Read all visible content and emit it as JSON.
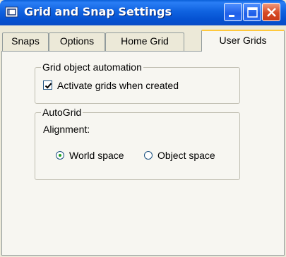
{
  "window": {
    "title": "Grid and Snap Settings",
    "icons": {
      "app": "grid-snap-app-icon",
      "minimize": "minimize-icon",
      "maximize": "maximize-icon",
      "close": "close-icon"
    },
    "colors": {
      "titlebar": "#0a5fd8",
      "close_button": "#d74a25",
      "active_tab_accent": "#ffc83c",
      "radio_selected": "#21a121"
    }
  },
  "tabs": [
    {
      "label": "Snaps",
      "active": false
    },
    {
      "label": "Options",
      "active": false
    },
    {
      "label": "Home Grid",
      "active": false
    },
    {
      "label": "User Grids",
      "active": true
    }
  ],
  "grid_object_automation": {
    "legend": "Grid object automation",
    "activate_checkbox": {
      "label": "Activate grids when created",
      "checked": true
    }
  },
  "autogrid": {
    "legend": "AutoGrid",
    "alignment_label": "Alignment:",
    "options": [
      {
        "label": "World space",
        "selected": true
      },
      {
        "label": "Object space",
        "selected": false
      }
    ]
  }
}
